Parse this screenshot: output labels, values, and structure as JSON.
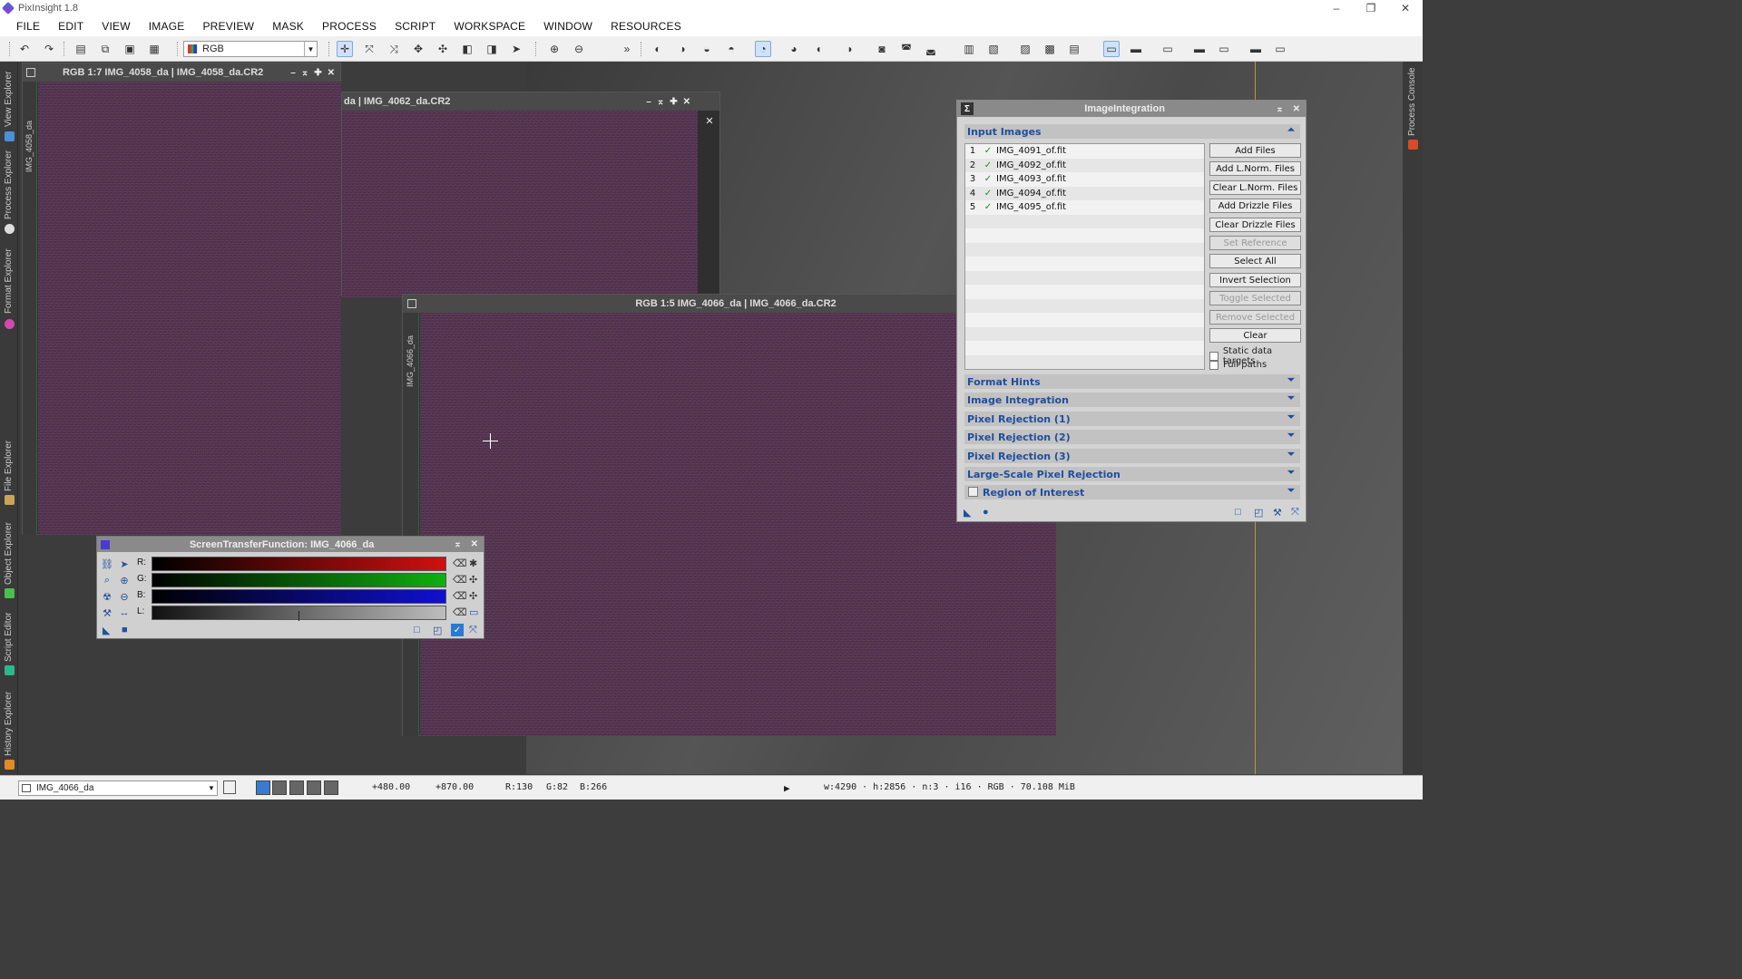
{
  "app": {
    "title": "PixInsight 1.8"
  },
  "window_controls": {
    "minimize": "–",
    "maximize": "❐",
    "close": "✕"
  },
  "menu": [
    "FILE",
    "EDIT",
    "VIEW",
    "IMAGE",
    "PREVIEW",
    "MASK",
    "PROCESS",
    "SCRIPT",
    "WORKSPACE",
    "WINDOW",
    "RESOURCES"
  ],
  "toolbar": {
    "rgb_select": "RGB",
    "overflow": "»"
  },
  "side_tabs_left": [
    "View Explorer",
    "Process Explorer",
    "Format Explorer",
    "File Explorer",
    "Object Explorer",
    "Script Editor",
    "History Explorer"
  ],
  "side_tabs_right": [
    "Process Console"
  ],
  "windows": {
    "win1": {
      "title": "RGB 1:7 IMG_4058_da | IMG_4058_da.CR2",
      "tab": "IMG_4058_da"
    },
    "win2": {
      "title": "da | IMG_4062_da.CR2"
    },
    "win3": {
      "title": "RGB 1:5 IMG_4066_da | IMG_4066_da.CR2",
      "tab": "IMG_4066_da"
    }
  },
  "image_integration": {
    "title": "ImageIntegration",
    "input_images_label": "Input Images",
    "files": [
      {
        "n": "1",
        "name": "IMG_4091_of.fit"
      },
      {
        "n": "2",
        "name": "IMG_4092_of.fit"
      },
      {
        "n": "3",
        "name": "IMG_4093_of.fit"
      },
      {
        "n": "4",
        "name": "IMG_4094_of.fit"
      },
      {
        "n": "5",
        "name": "IMG_4095_of.fit"
      }
    ],
    "buttons": {
      "add_files": "Add Files",
      "add_lnorm": "Add L.Norm. Files",
      "clear_lnorm": "Clear L.Norm. Files",
      "add_drizzle": "Add Drizzle Files",
      "clear_drizzle": "Clear Drizzle Files",
      "set_reference": "Set Reference",
      "select_all": "Select All",
      "invert_selection": "Invert Selection",
      "toggle_selected": "Toggle Selected",
      "remove_selected": "Remove Selected",
      "clear": "Clear"
    },
    "checkboxes": {
      "static_data_targets": "Static data targets",
      "full_paths": "Full paths"
    },
    "sections": [
      "Format Hints",
      "Image Integration",
      "Pixel Rejection (1)",
      "Pixel Rejection (2)",
      "Pixel Rejection (3)",
      "Large-Scale Pixel Rejection",
      "Region of Interest"
    ]
  },
  "stf": {
    "title": "ScreenTransferFunction: IMG_4066_da",
    "channels": [
      {
        "label": "R:",
        "color": "#d01010"
      },
      {
        "label": "G:",
        "color": "#10b010"
      },
      {
        "label": "B:",
        "color": "#1010d0"
      },
      {
        "label": "L:",
        "color": "#bdbdbd"
      }
    ]
  },
  "statusbar": {
    "view": "IMG_4066_da",
    "x": "+480.00",
    "y": "+870.00",
    "r": "R:130",
    "g": "G:82",
    "b": "B:266",
    "info": "w:4290 · h:2856 · n:3 · i16 · RGB · 70.108 MiB"
  }
}
